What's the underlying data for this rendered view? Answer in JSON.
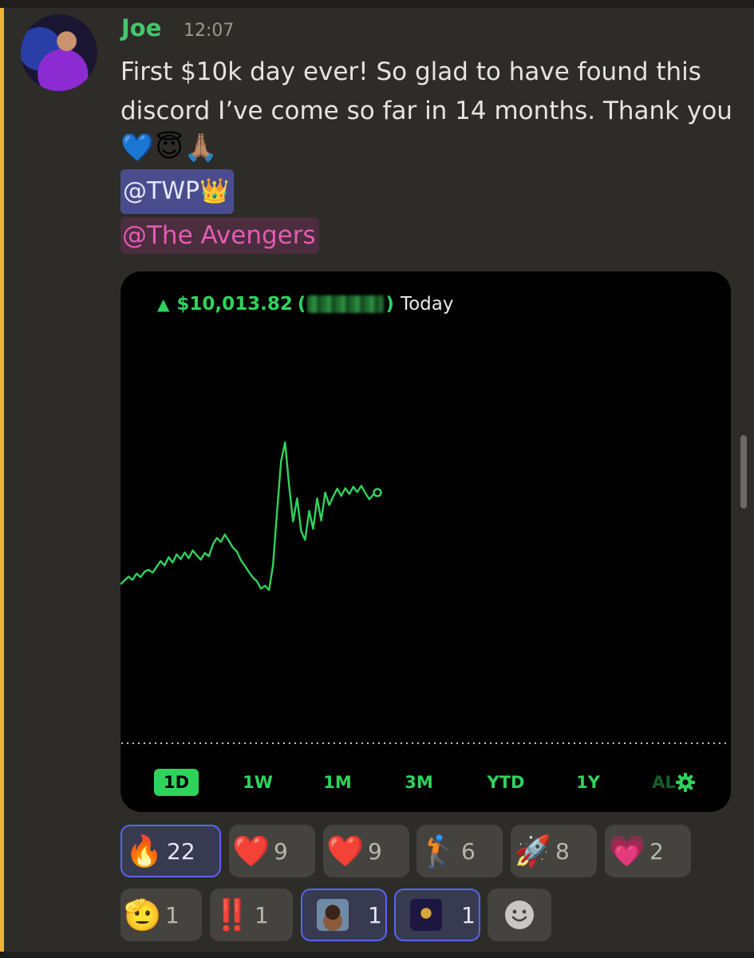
{
  "message": {
    "author": "Joe",
    "time": "12:07",
    "text": "First $10k day ever! So glad to have found this discord I’ve come so far in 14 months. Thank you",
    "emojis": [
      "💙",
      "😇",
      "🙏🏽"
    ],
    "mention_role_1": "@TWP",
    "mention_role_1_emoji": "👑",
    "mention_role_2": "@The Avengers"
  },
  "embed": {
    "gain": "$10,013.82",
    "paren_open": "(",
    "paren_close": ")",
    "period": "Today",
    "ranges": [
      "1D",
      "1W",
      "1M",
      "3M",
      "YTD",
      "1Y",
      "AL"
    ],
    "active_range": "1D",
    "line_color": "#2fd35c"
  },
  "chart_data": {
    "type": "line",
    "title": "",
    "xlabel": "",
    "ylabel": "",
    "series": [
      {
        "values": [
          0.0,
          0.8,
          1.6,
          0.9,
          2.2,
          1.5,
          2.6,
          3.0,
          2.4,
          3.6,
          4.8,
          3.9,
          5.6,
          4.5,
          6.2,
          5.2,
          6.6,
          5.4,
          7.0,
          6.0,
          5.1,
          6.5,
          5.8,
          8.2,
          9.6,
          8.8,
          10.3,
          9.0,
          7.6,
          6.8,
          5.0,
          3.8,
          2.5,
          1.4,
          0.6,
          -0.9,
          -0.3,
          -1.2,
          4.0,
          15.0,
          25.5,
          29.4,
          20.5,
          13.0,
          17.8,
          11.0,
          9.2,
          15.2,
          11.5,
          17.8,
          13.2,
          19.0,
          16.4,
          18.2,
          19.8,
          18.3,
          19.9,
          18.7,
          20.2,
          19.1,
          20.4,
          18.9,
          17.6,
          18.6,
          19.0
        ]
      }
    ],
    "ylim": [
      -3,
      40
    ],
    "grid": false,
    "colors": {
      "line": "#2fd35c"
    }
  },
  "reactions_row1": [
    {
      "emoji": "🔥",
      "count": "22",
      "selected": true
    },
    {
      "emoji": "❤️",
      "count": "9",
      "selected": false
    },
    {
      "emoji": "❤️",
      "count": "9",
      "selected": false
    },
    {
      "emoji": "🏌🏽",
      "count": "6",
      "selected": false
    },
    {
      "emoji": "🚀",
      "count": "8",
      "selected": false
    },
    {
      "emoji": "💗",
      "count": "2",
      "selected": false
    }
  ],
  "reactions_row2": [
    {
      "emoji": "🫡",
      "count": "1",
      "selected": false
    },
    {
      "emoji": "‼️",
      "count": "1",
      "selected": false
    },
    {
      "emoji": "custom-face-avatar",
      "count": "1",
      "selected": true
    },
    {
      "emoji": "custom-crest-emblem",
      "count": "1",
      "selected": true
    }
  ],
  "icons": {
    "add_reaction": "smiley-icon",
    "settings": "gear-icon"
  }
}
